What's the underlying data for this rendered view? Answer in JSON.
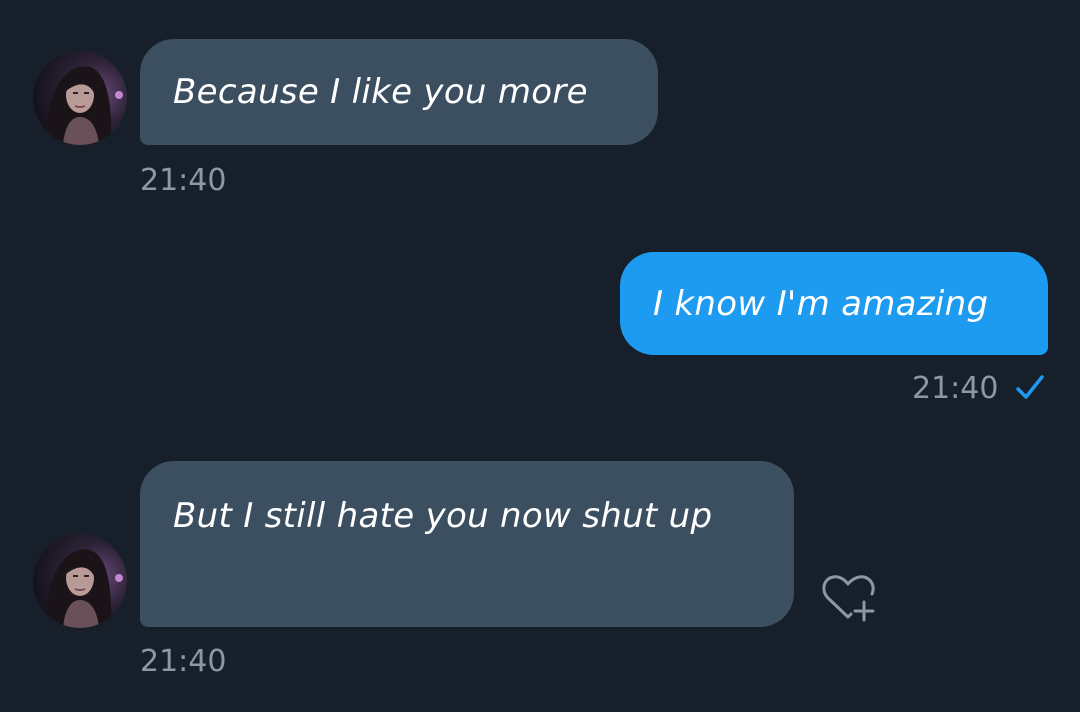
{
  "messages": [
    {
      "direction": "incoming",
      "text": "Because I like you more",
      "time": "21:40"
    },
    {
      "direction": "outgoing",
      "text": "I know I'm amazing",
      "time": "21:40",
      "status_icon": "check-icon"
    },
    {
      "direction": "incoming",
      "text": "But I still hate you now shut up",
      "time": "21:40"
    }
  ],
  "icons": {
    "avatar": "avatar",
    "read_receipt": "check-icon",
    "react": "heart-plus-icon"
  },
  "colors": {
    "background": "#17202a",
    "incoming_bubble": "#3c4f60",
    "outgoing_bubble": "#1d9bf0",
    "timestamp": "#8b98a5",
    "check": "#1d9bf0"
  }
}
